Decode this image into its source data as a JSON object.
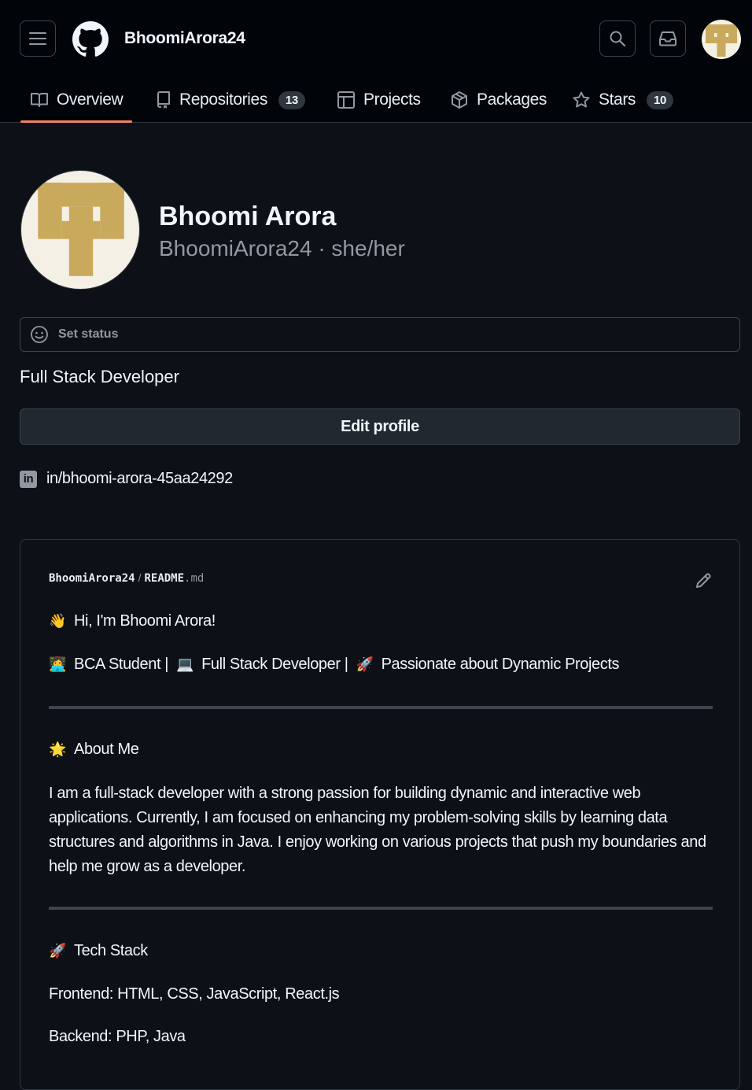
{
  "header": {
    "username": "BhoomiArora24",
    "menu_icon": "hamburger-icon",
    "logo_icon": "github-logo-icon",
    "search_icon": "search-icon",
    "inbox_icon": "inbox-icon"
  },
  "tabs": [
    {
      "label": "Overview",
      "icon": "book-icon",
      "active": true
    },
    {
      "label": "Repositories",
      "icon": "repo-icon",
      "count": "13"
    },
    {
      "label": "Projects",
      "icon": "table-icon"
    },
    {
      "label": "Packages",
      "icon": "package-icon"
    },
    {
      "label": "Stars",
      "icon": "star-icon",
      "count": "10"
    }
  ],
  "profile": {
    "name": "Bhoomi Arora",
    "login_pronouns": "BhoomiArora24 · she/her",
    "status_placeholder": "Set status",
    "bio": "Full Stack Developer",
    "edit_button": "Edit profile",
    "social_link": "in/bhoomi-arora-45aa24292",
    "social_icon_text": "in"
  },
  "readme": {
    "owner": "BhoomiArora24",
    "separator": "/",
    "file": "README",
    "ext": ".md",
    "greeting_emoji": "👋",
    "greeting": "Hi, I'm Bhoomi Arora!",
    "tagline": {
      "e1": "👩‍💻",
      "t1": "BCA Student |",
      "e2": "💻",
      "t2": "Full Stack Developer |",
      "e3": "🚀",
      "t3": "Passionate about Dynamic Projects"
    },
    "about_emoji": "🌟",
    "about_heading": "About Me",
    "about_text": "I am a full-stack developer with a strong passion for building dynamic and interactive web applications. Currently, I am focused on enhancing my problem-solving skills by learning data structures and algorithms in Java. I enjoy working on various projects that push my boundaries and help me grow as a developer.",
    "tech_emoji": "🚀",
    "tech_heading": "Tech Stack",
    "frontend": "Frontend: HTML, CSS, JavaScript, React.js",
    "backend": "Backend: PHP, Java"
  },
  "colors": {
    "background": "#0d1117",
    "header_bg": "#010409",
    "active_tab_underline": "#f78166",
    "avatar_gold": "#c9a95b",
    "avatar_bg": "#f4f0e6"
  }
}
